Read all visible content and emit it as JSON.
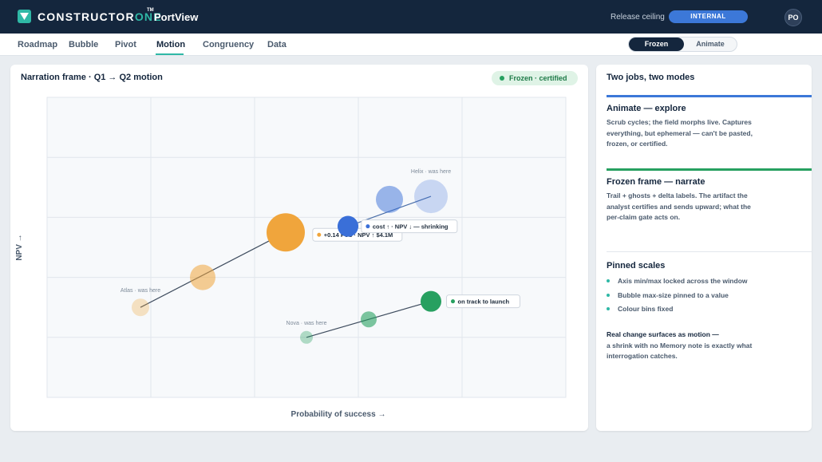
{
  "app": {
    "brand_main": "CONSTRUCTOR",
    "brand_accent": "ONE",
    "brand_tm": "TM",
    "product": "PortView",
    "release_label": "Release ceiling",
    "release_value": "INTERNAL",
    "avatar": "PO"
  },
  "tabs": [
    {
      "label": "Roadmap",
      "active": false
    },
    {
      "label": "Bubble",
      "active": false
    },
    {
      "label": "Pivot",
      "active": false
    },
    {
      "label": "Motion",
      "active": true
    },
    {
      "label": "Congruency",
      "active": false
    },
    {
      "label": "Data",
      "active": false
    }
  ],
  "mode_toggle": {
    "frozen": "Frozen",
    "animate": "Animate",
    "selected": "Frozen"
  },
  "chart_panel": {
    "title": "Narration frame · Q1 → Q2 motion",
    "status": "Frozen · certified"
  },
  "chart_data": {
    "type": "scatter",
    "xlabel": "Probability of success →",
    "ylabel": "NPV →",
    "xlim": [
      0,
      5
    ],
    "ylim": [
      0,
      5
    ],
    "grid": true,
    "tracks": [
      {
        "name": "Atlas",
        "color": "#f0a53c",
        "ghost_label": "Atlas · was here",
        "points": [
          {
            "x": 0.9,
            "y": 1.5,
            "r": 11,
            "opacity": 0.3
          },
          {
            "x": 1.5,
            "y": 2.0,
            "r": 16,
            "opacity": 0.55
          },
          {
            "x": 2.3,
            "y": 2.75,
            "r": 24,
            "opacity": 1
          }
        ],
        "label": "+0.14 PoS · NPV ↑ $4.1M"
      },
      {
        "name": "Helix",
        "color": "#3a6fd8",
        "ghost_label": "Helix · was here",
        "points": [
          {
            "x": 3.7,
            "y": 3.35,
            "r": 21,
            "opacity": 0.25
          },
          {
            "x": 3.3,
            "y": 3.3,
            "r": 17,
            "opacity": 0.5
          },
          {
            "x": 2.9,
            "y": 2.85,
            "r": 13,
            "opacity": 1
          }
        ],
        "label": "cost ↑ · NPV ↓ — shrinking"
      },
      {
        "name": "Nova",
        "color": "#27a060",
        "ghost_label": "Nova · was here",
        "points": [
          {
            "x": 2.5,
            "y": 1.0,
            "r": 8,
            "opacity": 0.35
          },
          {
            "x": 3.1,
            "y": 1.3,
            "r": 10,
            "opacity": 0.6
          },
          {
            "x": 3.7,
            "y": 1.6,
            "r": 13,
            "opacity": 1
          }
        ],
        "label": "on track to launch"
      }
    ]
  },
  "side": {
    "title": "Two jobs, two modes",
    "animate_title": "Animate — explore",
    "animate_body": "Scrub cycles; the field morphs live. Captures everything, but ephemeral — can't be pasted, frozen, or certified.",
    "frozen_title": "Frozen frame — narrate",
    "frozen_body": "Trail + ghosts + delta labels. The artifact the analyst certifies and sends upward; what the per-claim gate acts on.",
    "pinned_title": "Pinned scales",
    "pinned_items": [
      "Axis min/max locked across the window",
      "Bubble max-size pinned to a value",
      "Colour bins fixed"
    ],
    "closing_bold": "Real change surfaces as motion —",
    "closing_rest": "a shrink with no Memory note is exactly what interrogation catches."
  }
}
